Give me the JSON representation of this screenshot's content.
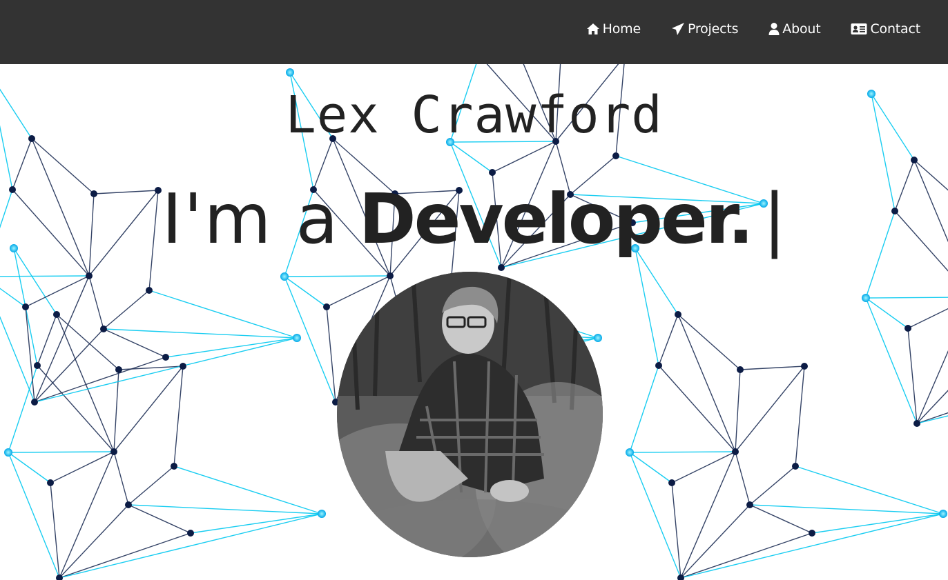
{
  "nav": {
    "items": [
      {
        "label": "Home",
        "icon": "home-icon"
      },
      {
        "label": "Projects",
        "icon": "paper-plane-icon"
      },
      {
        "label": "About",
        "icon": "user-icon"
      },
      {
        "label": "Contact",
        "icon": "contact-card-icon"
      }
    ]
  },
  "hero": {
    "name": "Lex Crawford",
    "tagline_prefix": "I'm a",
    "tagline_role": "Developer.",
    "cursor": "|"
  },
  "colors": {
    "navbar_bg": "#333333",
    "nav_text": "#ffffff",
    "network_line_dark": "#1e2f55",
    "network_node_dark": "#0c1c45",
    "network_node_light": "#00c8f0",
    "heading_text": "#222222"
  }
}
